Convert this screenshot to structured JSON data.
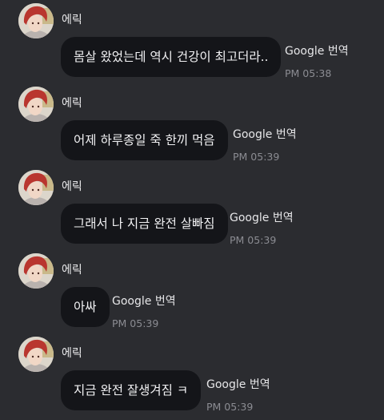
{
  "chat": {
    "messages": [
      {
        "sender": "에릭",
        "text": "몸살 왔었는데 역시 건강이 최고더라..",
        "translate_label": "Google 번역",
        "time": "PM 05:38"
      },
      {
        "sender": "에릭",
        "text": "어제 하루종일 죽 한끼 먹음",
        "translate_label": "Google 번역",
        "time": "PM 05:39"
      },
      {
        "sender": "에릭",
        "text": "그래서 나 지금 완전 살빠짐",
        "translate_label": "Google 번역",
        "time": "PM 05:39"
      },
      {
        "sender": "에릭",
        "text": "아싸",
        "translate_label": "Google 번역",
        "time": "PM 05:39"
      },
      {
        "sender": "에릭",
        "text": "지금 완전 잘생겨짐 ㅋ",
        "translate_label": "Google 번역",
        "time": "PM 05:39"
      }
    ]
  },
  "icons": {
    "avatar": "profile-photo"
  },
  "colors": {
    "background": "#2b2c30",
    "bubble": "#141519",
    "text": "#f2f2f4",
    "timestamp": "#8b8c92"
  }
}
